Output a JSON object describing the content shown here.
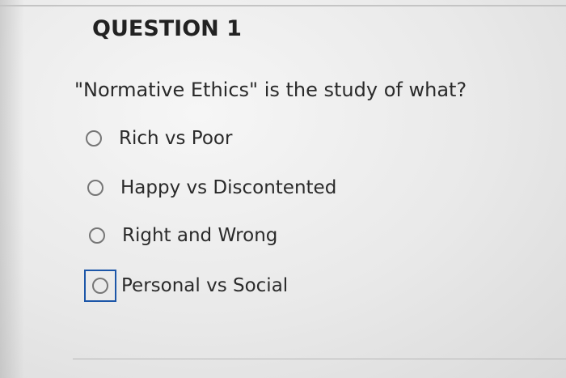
{
  "question": {
    "heading": "QUESTION 1",
    "text": "\"Normative Ethics\" is the study of what?",
    "options": [
      {
        "label": "Rich vs Poor",
        "selected": false,
        "focused": false
      },
      {
        "label": "Happy vs Discontented",
        "selected": false,
        "focused": false
      },
      {
        "label": "Right and Wrong",
        "selected": false,
        "focused": false
      },
      {
        "label": "Personal vs Social",
        "selected": false,
        "focused": true
      }
    ]
  },
  "colors": {
    "focus_ring": "#1c56a8",
    "radio_border": "#767676",
    "text": "#2a2a2a"
  }
}
